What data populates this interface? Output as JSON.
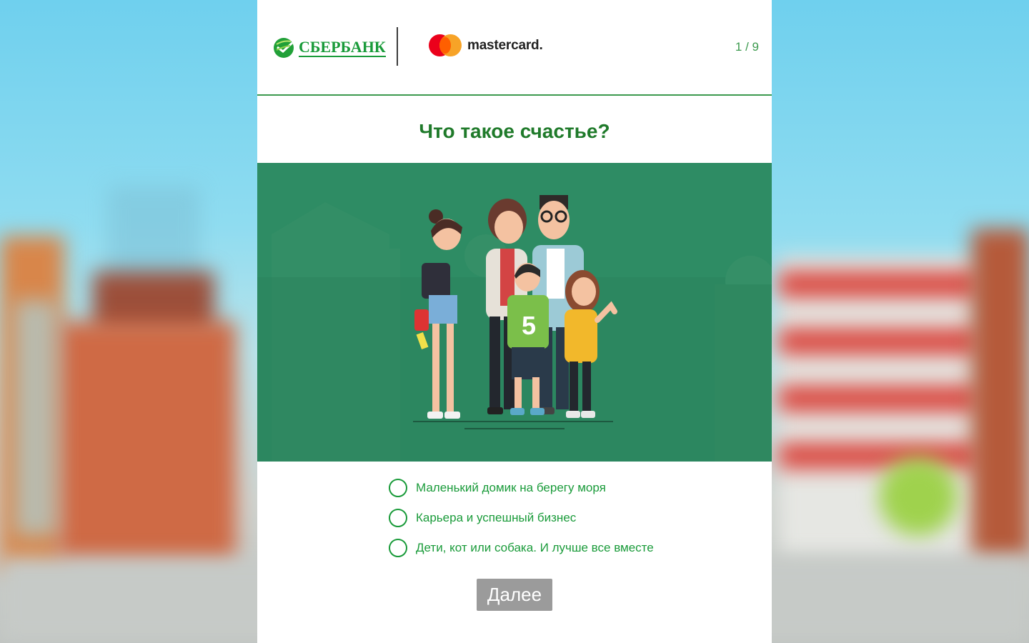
{
  "header": {
    "sber_logo_text": "СБЕРБАНК",
    "mastercard_text": "mastercard.",
    "progress": "1 / 9"
  },
  "quiz": {
    "question": "Что такое счастье?",
    "illustration": "family-illustration",
    "options": [
      {
        "label": "Маленький домик на берегу моря"
      },
      {
        "label": "Карьера и успешный бизнес"
      },
      {
        "label": "Дети, кот или собака. И лучше все вместе"
      }
    ],
    "next_label": "Далее"
  },
  "colors": {
    "brand_green": "#1a9b3a",
    "illustration_bg": "#2e8c64",
    "button_bg": "#9b9b9b",
    "mc_red": "#eb001b",
    "mc_orange": "#f79e1b"
  }
}
